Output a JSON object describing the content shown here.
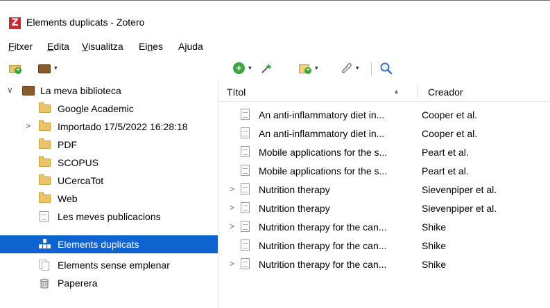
{
  "window": {
    "title": "Elements duplicats - Zotero",
    "logo_letter": "Z"
  },
  "menu": [
    {
      "label": "Fitxer",
      "underline_index": 0
    },
    {
      "label": "Edita",
      "underline_index": 0
    },
    {
      "label": "Visualitza",
      "underline_index": 0
    },
    {
      "label": "Eines",
      "underline_index": 2
    },
    {
      "label": "Ajuda",
      "underline_index": 1
    }
  ],
  "toolbar": {
    "icons": [
      "new-collection-icon",
      "new-library-icon",
      "new-item-icon",
      "add-by-identifier-icon",
      "new-note-icon",
      "add-attachment-icon",
      "search-icon"
    ],
    "dropdown_glyph": "▾"
  },
  "collections": [
    {
      "label": "La meva biblioteca",
      "icon": "library-icon",
      "twisty": "∨",
      "level": 0
    },
    {
      "label": "Google Academic",
      "icon": "folder-icon",
      "twisty": "",
      "level": 1
    },
    {
      "label": "Importado 17/5/2022 16:28:18",
      "icon": "folder-icon",
      "twisty": ">",
      "level": 1
    },
    {
      "label": "PDF",
      "icon": "folder-icon",
      "twisty": "",
      "level": 1
    },
    {
      "label": "SCOPUS",
      "icon": "folder-icon",
      "twisty": "",
      "level": 1
    },
    {
      "label": "UCercaTot",
      "icon": "folder-icon",
      "twisty": "",
      "level": 1
    },
    {
      "label": "Web",
      "icon": "folder-icon",
      "twisty": "",
      "level": 1
    },
    {
      "label": "Les meves publicacions",
      "icon": "document-icon",
      "twisty": "",
      "level": 1
    },
    {
      "label": "Elements duplicats",
      "icon": "duplicates-icon",
      "twisty": "",
      "level": 1,
      "selected": true
    },
    {
      "label": "Elements sense emplenar",
      "icon": "unfiled-icon",
      "twisty": "",
      "level": 1
    },
    {
      "label": "Paperera",
      "icon": "trash-icon",
      "twisty": "",
      "level": 1
    }
  ],
  "items_table": {
    "columns": {
      "title": "Títol",
      "creator": "Creador",
      "sort_glyph": "▲"
    },
    "rows": [
      {
        "title": "An anti-inflammatory diet in...",
        "creator": "Cooper et al.",
        "expandable": false
      },
      {
        "title": "An anti-inflammatory diet in...",
        "creator": "Cooper et al.",
        "expandable": false
      },
      {
        "title": "Mobile applications for the s...",
        "creator": "Peart et al.",
        "expandable": false
      },
      {
        "title": "Mobile applications for the s...",
        "creator": "Peart et al.",
        "expandable": false
      },
      {
        "title": "Nutrition therapy",
        "creator": "Sievenpiper et al.",
        "expandable": true
      },
      {
        "title": "Nutrition therapy",
        "creator": "Sievenpiper et al.",
        "expandable": true
      },
      {
        "title": "Nutrition therapy for the can...",
        "creator": "Shike",
        "expandable": true
      },
      {
        "title": "Nutrition therapy for the can...",
        "creator": "Shike",
        "expandable": false
      },
      {
        "title": "Nutrition therapy for the can...",
        "creator": "Shike",
        "expandable": true
      }
    ]
  },
  "colors": {
    "selection": "#0d63cf",
    "folder": "#e9c46a",
    "accent_green": "#3aa53a",
    "logo_red": "#cc2936"
  }
}
